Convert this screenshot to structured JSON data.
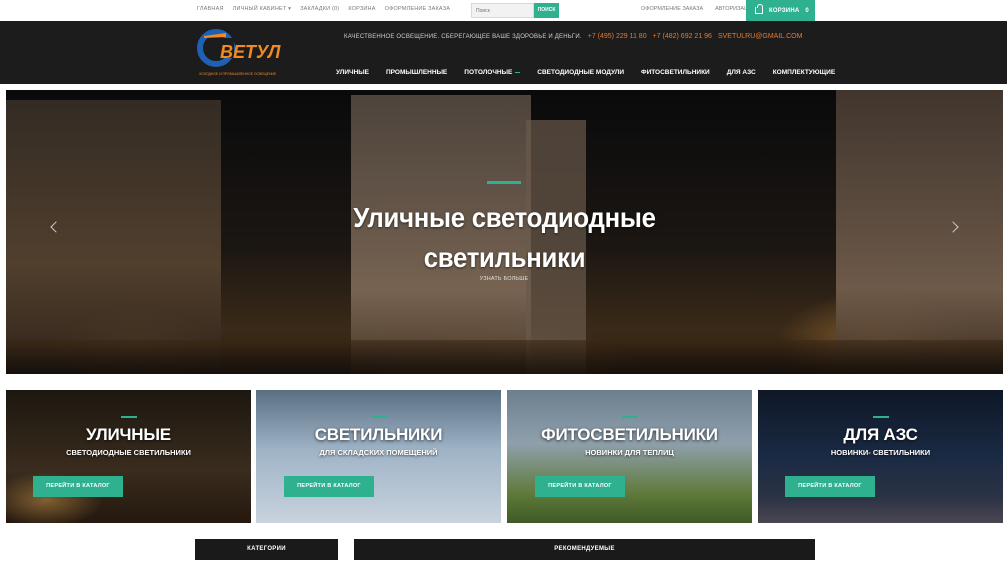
{
  "topbar": {
    "links": [
      "ГЛАВНАЯ",
      "ЛИЧНЫЙ КАБИНЕТ ▾",
      "ЗАКЛАДКИ (0)",
      "КОРЗИНА",
      "ОФОРМЛЕНИЕ ЗАКАЗА"
    ],
    "search_placeholder": "Поиск",
    "search_button": "ПОИСК",
    "account_links": [
      "ОФОРМЛЕНИЕ ЗАКАЗА",
      "АВТОРИЗАЦИЯ"
    ],
    "cart_label": "КОРЗИНА",
    "cart_count": "0"
  },
  "header": {
    "logo_text": "ВЕТУЛ",
    "logo_letter": "С",
    "logo_sub": "ХОЛОДНОЕ И ПРОМЫШЛЕННОЕ ОСВЕЩЕНИЕ",
    "tagline": "КАЧЕСТВЕННОЕ ОСВЕЩЕНИЕ. СБЕРЕГАЮЩЕЕ ВАШЕ ЗДОРОВЬЕ И ДЕНЬГИ.",
    "phone1": "+7 (495) 229 11 80",
    "phone2": "+7 (482) 692 21 96",
    "email": "SVETULRU@GMAIL.COM",
    "nav": [
      "УЛИЧНЫЕ",
      "ПРОМЫШЛЕННЫЕ",
      "ПОТОЛОЧНЫЕ",
      "СВЕТОДИОДНЫЕ МОДУЛИ",
      "ФИТОСВЕТИЛЬНИКИ",
      "ДЛЯ АЗС",
      "КОМПЛЕКТУЮЩИЕ"
    ]
  },
  "hero": {
    "title": "Уличные светодиодные светильники",
    "more": "УЗНАТЬ БОЛЬШЕ"
  },
  "tiles": [
    {
      "title": "УЛИЧНЫЕ",
      "subtitle": "СВЕТОДИОДНЫЕ СВЕТИЛЬНИКИ",
      "button": "ПЕРЕЙТИ В КАТАЛОГ"
    },
    {
      "title": "СВЕТИЛЬНИКИ",
      "subtitle": "ДЛЯ СКЛАДСКИХ ПОМЕЩЕНИЙ",
      "button": "ПЕРЕЙТИ В КАТАЛОГ"
    },
    {
      "title": "ФИТОСВЕТИЛЬНИКИ",
      "subtitle": "НОВИНКИ ДЛЯ ТЕПЛИЦ",
      "button": "ПЕРЕЙТИ В КАТАЛОГ"
    },
    {
      "title": "ДЛЯ АЗС",
      "subtitle": "НОВИНКИ- СВЕТИЛЬНИКИ",
      "button": "ПЕРЕЙТИ В КАТАЛОГ"
    }
  ],
  "tabs": {
    "categories": "КАТЕГОРИИ",
    "recommended": "РЕКОМЕНДУЕМЫЕ"
  },
  "colors": {
    "accent": "#2fb190",
    "header_bg": "#1c1c1c",
    "phone": "#e87b2c",
    "logo_blue": "#1f5fb4",
    "logo_orange": "#f08a24"
  }
}
